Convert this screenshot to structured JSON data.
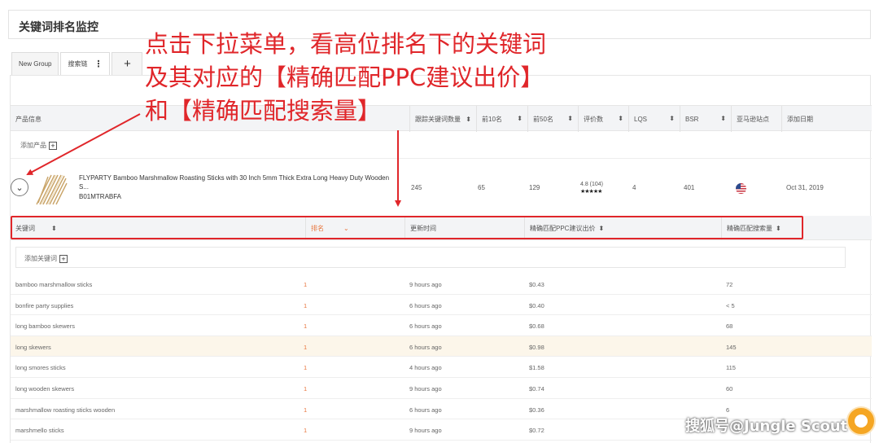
{
  "page_title": "关键词排名监控",
  "tabs": [
    {
      "label": "New Group"
    },
    {
      "label": "搜索链",
      "menu_icon": "⋮"
    },
    {
      "label": "+"
    }
  ],
  "product_table": {
    "headers": [
      "产品信息",
      "跟踪关键词数量",
      "前10名",
      "前50名",
      "评价数",
      "LQS",
      "BSR",
      "亚马逊站点",
      "添加日期"
    ],
    "sort_icon": "⬍",
    "add_product_label": "添加产品",
    "product": {
      "title": "FLYPARTY Bamboo Marshmallow Roasting Sticks with 30 Inch 5mm Thick Extra Long Heavy Duty Wooden S...",
      "asin": "B01MTRABFA",
      "tracked_keywords": "245",
      "top10": "65",
      "top50": "129",
      "rating": "4.8 (104)",
      "stars": "★★★★★",
      "lqs": "4",
      "bsr": "401",
      "marketplace_icon": "us-flag-icon",
      "date_added": "Oct 31, 2019"
    }
  },
  "keyword_table": {
    "headers": [
      "关键词",
      "排名",
      "更新时间",
      "精确匹配PPC建议出价",
      "精确匹配搜索量"
    ],
    "add_keyword_label": "添加关键词",
    "rows": [
      {
        "keyword": "bamboo marshmallow sticks",
        "rank": "1",
        "updated": "9 hours ago",
        "bid": "$0.43",
        "volume": "72"
      },
      {
        "keyword": "bonfire party supplies",
        "rank": "1",
        "updated": "6 hours ago",
        "bid": "$0.40",
        "volume": "< 5"
      },
      {
        "keyword": "long bamboo skewers",
        "rank": "1",
        "updated": "6 hours ago",
        "bid": "$0.68",
        "volume": "68"
      },
      {
        "keyword": "long skewers",
        "rank": "1",
        "updated": "6 hours ago",
        "bid": "$0.98",
        "volume": "145"
      },
      {
        "keyword": "long smores sticks",
        "rank": "1",
        "updated": "4 hours ago",
        "bid": "$1.58",
        "volume": "115"
      },
      {
        "keyword": "long wooden skewers",
        "rank": "1",
        "updated": "9 hours ago",
        "bid": "$0.74",
        "volume": "60"
      },
      {
        "keyword": "marshmallow roasting sticks wooden",
        "rank": "1",
        "updated": "6 hours ago",
        "bid": "$0.36",
        "volume": "6"
      },
      {
        "keyword": "marshmello sticks",
        "rank": "1",
        "updated": "9 hours ago",
        "bid": "$0.72",
        "volume": ""
      }
    ]
  },
  "annotation": {
    "line1": "点击下拉菜单，看高位排名下的关键词",
    "line2": "及其对应的【精确匹配PPC建议出价】",
    "line3": "和【精确匹配搜索量】"
  },
  "watermark": "搜狐号@Jungle Scout",
  "colors": {
    "annotation_red": "#e0262a",
    "rank_orange": "#e8743b",
    "highlight_row": "#fcf6ea",
    "help_button": "#f5a623"
  }
}
